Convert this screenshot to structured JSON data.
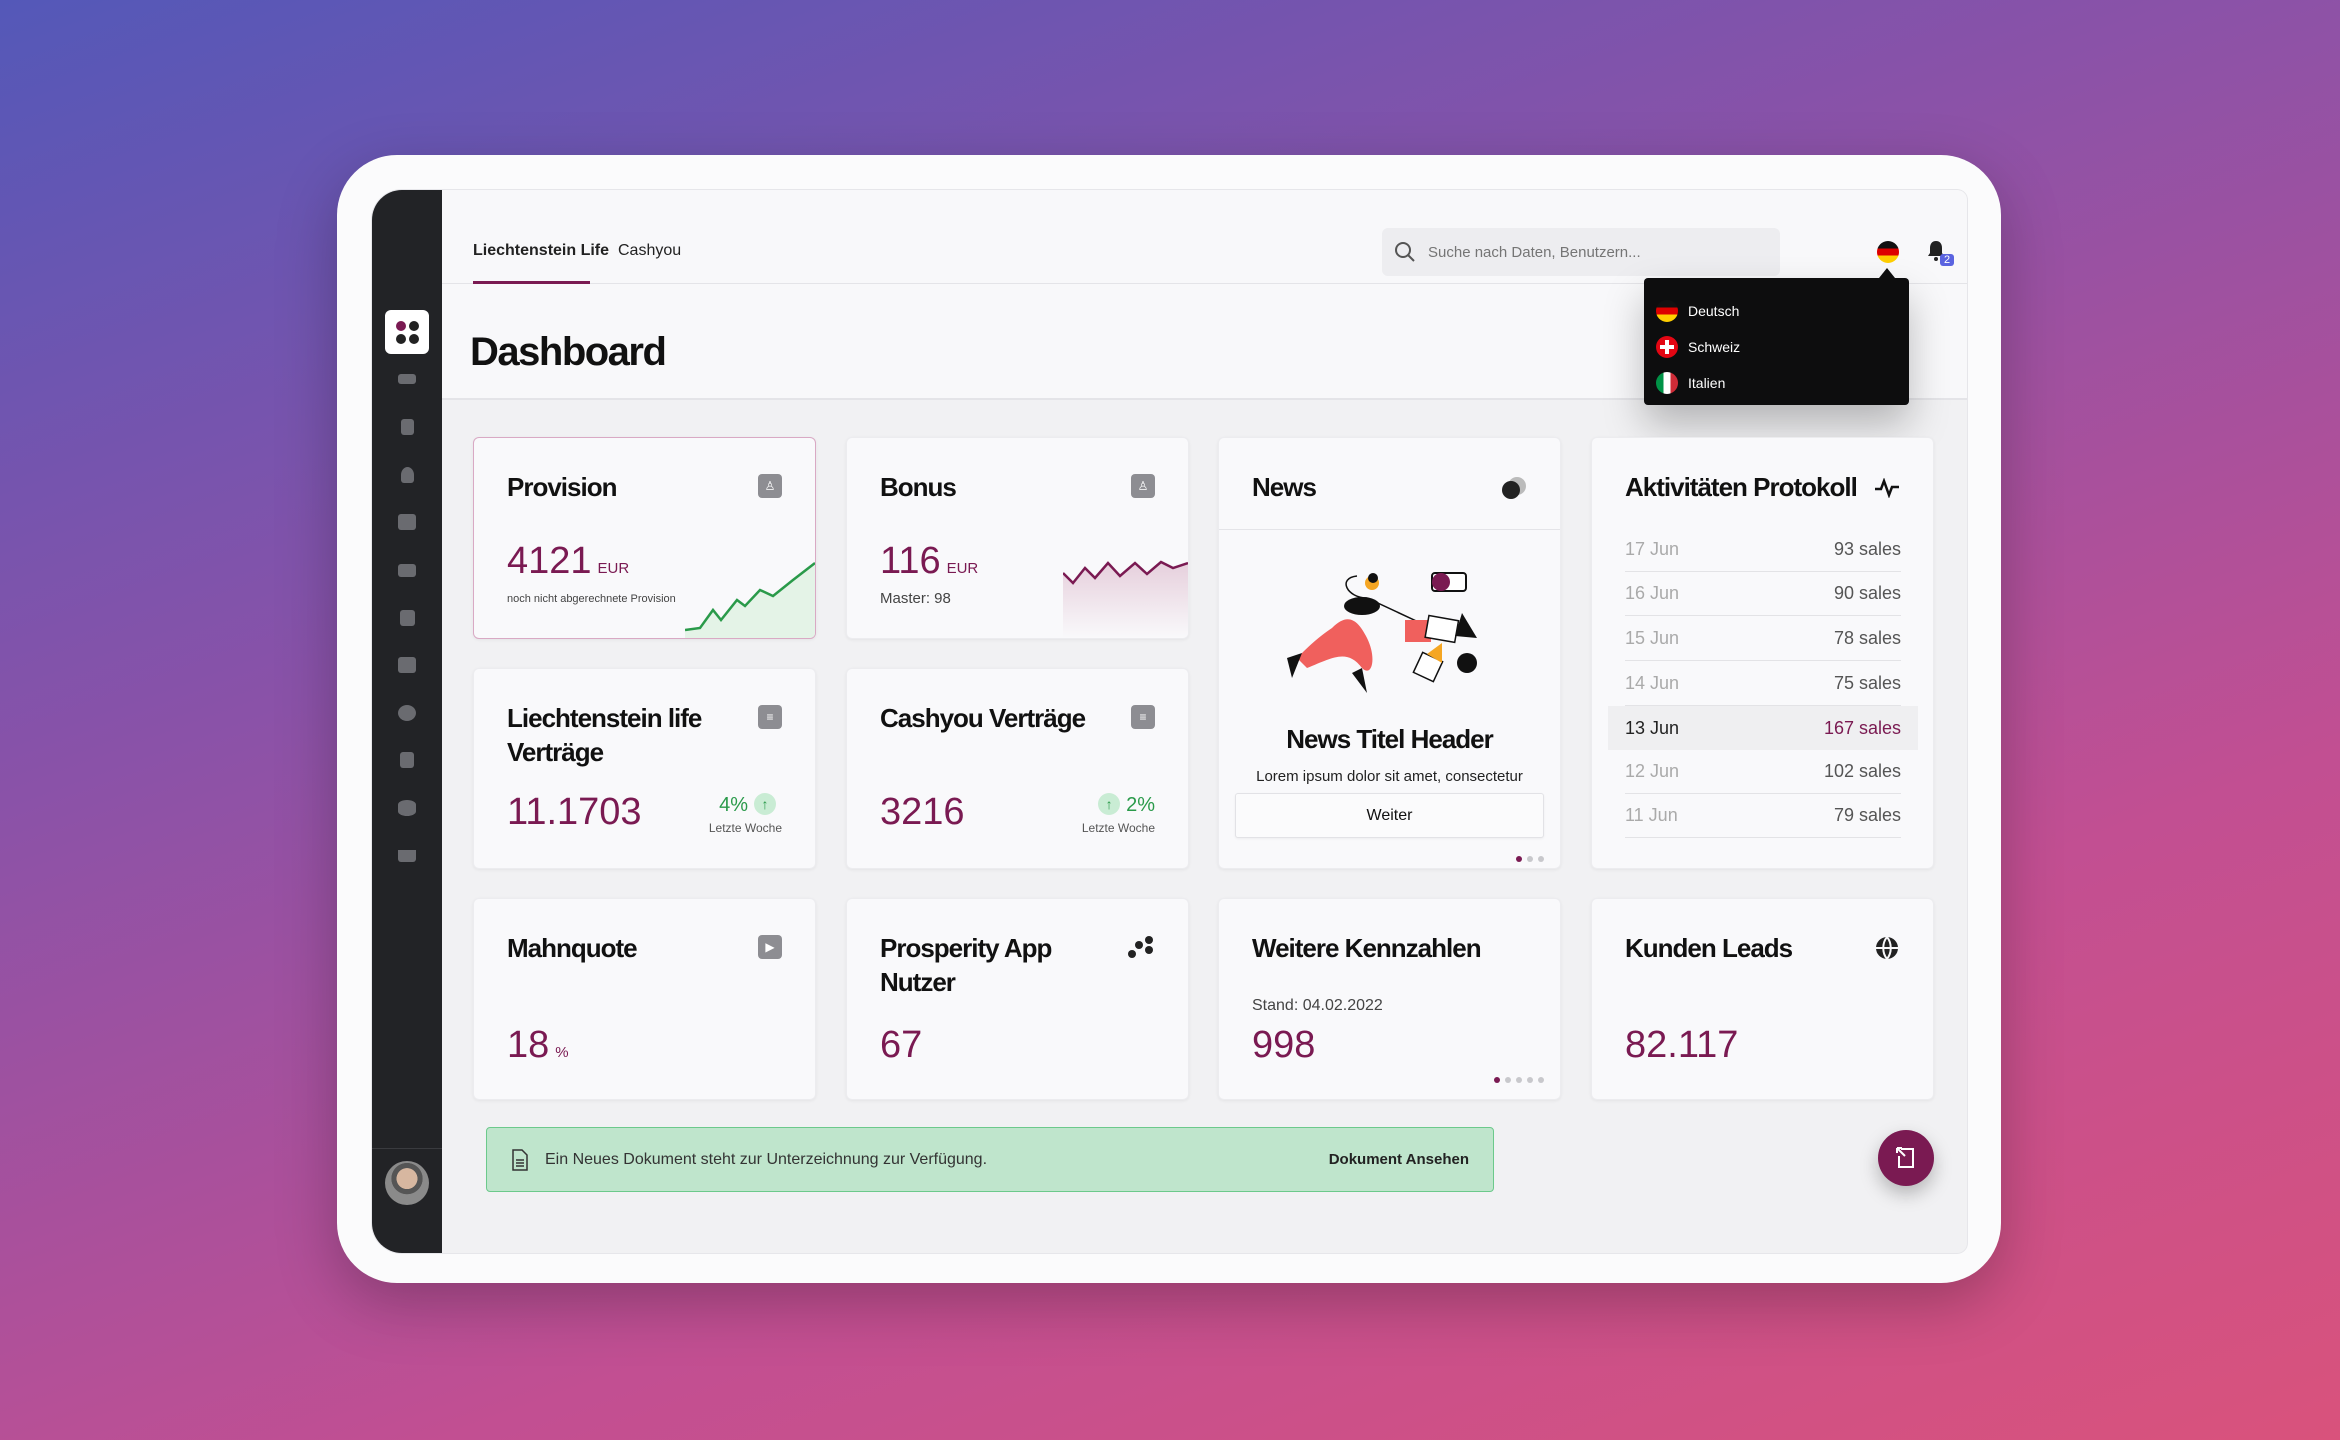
{
  "tabs": [
    {
      "label": "Liechtenstein Life",
      "active": true
    },
    {
      "label": "Cashyou",
      "active": false
    }
  ],
  "search": {
    "placeholder": "Suche nach Daten, Benutzern..."
  },
  "notifications": {
    "count": "2"
  },
  "language_menu": {
    "items": [
      {
        "label": "Deutsch"
      },
      {
        "label": "Schweiz"
      },
      {
        "label": "Italien"
      }
    ]
  },
  "page": {
    "title": "Dashboard"
  },
  "cards": {
    "provision": {
      "title": "Provision",
      "value": "4121",
      "unit": "EUR",
      "sub": "noch nicht abgerechnete Provision"
    },
    "bonus": {
      "title": "Bonus",
      "value": "116",
      "unit": "EUR",
      "sub": "Master: 98"
    },
    "news": {
      "title": "News",
      "headline": "News Titel Header",
      "text": "Lorem ipsum dolor sit amet, consectetur",
      "button": "Weiter"
    },
    "activity": {
      "title": "Aktivitäten Protokoll",
      "rows": [
        {
          "date": "17 Jun",
          "sales": "93 sales"
        },
        {
          "date": "16 Jun",
          "sales": "90 sales"
        },
        {
          "date": "15 Jun",
          "sales": "78 sales"
        },
        {
          "date": "14 Jun",
          "sales": "75 sales"
        },
        {
          "date": "13 Jun",
          "sales": "167 sales"
        },
        {
          "date": "12 Jun",
          "sales": "102 sales"
        },
        {
          "date": "11 Jun",
          "sales": "79 sales"
        }
      ]
    },
    "ll_vertraege": {
      "title": "Liechtenstein life Verträge",
      "value": "11.1703",
      "trend": "4%",
      "trend_label": "Letzte Woche"
    },
    "cashyou_vertraege": {
      "title": "Cashyou Verträge",
      "value": "3216",
      "trend": "2%",
      "trend_label": "Letzte Woche"
    },
    "mahnquote": {
      "title": "Mahnquote",
      "value": "18",
      "unit": "%"
    },
    "prosperity": {
      "title": "Prosperity App Nutzer",
      "value": "67"
    },
    "kennzahlen": {
      "title": "Weitere Kennzahlen",
      "stand": "Stand: 04.02.2022",
      "value": "998"
    },
    "leads": {
      "title": "Kunden Leads",
      "value": "82.117"
    }
  },
  "banner": {
    "text": "Ein Neues Dokument steht zur Unterzeichnung zur Verfügung.",
    "action": "Dokument Ansehen"
  },
  "colors": {
    "accent": "#7a1a52",
    "success": "#2a9a4a",
    "sidebar": "#222326"
  }
}
